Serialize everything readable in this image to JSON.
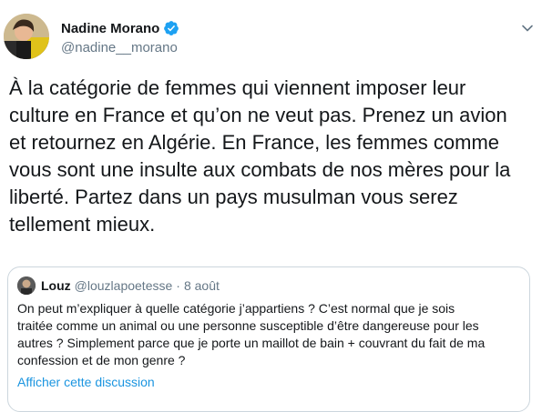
{
  "author": {
    "display_name": "Nadine Morano",
    "handle": "@nadine__morano",
    "verified": true,
    "avatar_icon": "profile-photo"
  },
  "tweet": {
    "text": "À la catégorie de femmes qui viennent imposer leur\nculture en France et qu’on ne veut pas. Prenez un avion\net retournez en Algérie. En France, les femmes comme\nvous sont une insulte aux combats de nos mères pour la\nliberté. Partez dans un pays musulman vous serez\ntellement mieux."
  },
  "quoted_tweet": {
    "display_name": "Louz",
    "handle": "@louzlapoetesse",
    "separator": "·",
    "date": "8 août",
    "text": "On peut m’expliquer à quelle catégorie j’appartiens ? C’est normal que je sois\ntraitée comme un animal ou une personne susceptible d’être dangereuse pour les\nautres ? Simplement parce que je porte un maillot de bain + couvrant du fait de ma\nconfession et de mon genre ?",
    "show_thread_label": "Afficher cette discussion"
  },
  "colors": {
    "primary_text": "#14171a",
    "secondary_text": "#657786",
    "link": "#1b95e0",
    "verified": "#1da1f2",
    "border": "#ccd6dd"
  },
  "icons": {
    "verified": "verified-badge-icon",
    "caret": "chevron-down-icon"
  }
}
